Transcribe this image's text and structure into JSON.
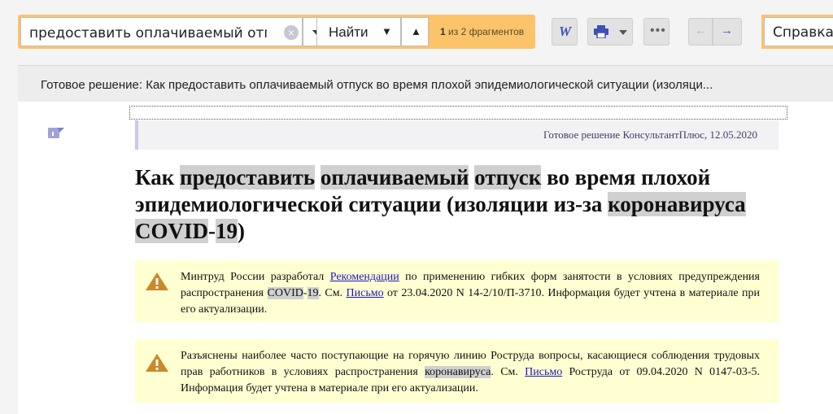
{
  "search": {
    "query": "предоставить оплачиваемый отп",
    "find_label": "Найти",
    "find_next_icon": "arrow-down",
    "find_prev_icon": "arrow-up",
    "count_current": "1",
    "count_suffix": "из 2 фрагментов"
  },
  "toolbar": {
    "word_label": "W",
    "more_label": "•••",
    "back_glyph": "←",
    "forward_glyph": "→",
    "help_label": "Справка"
  },
  "doc": {
    "header_title": "Готовое решение: Как предоставить оплачиваемый отпуск во время плохой эпидемиологической ситуации (изоляци...",
    "source": "Готовое решение КонсультантПлюс, 12.05.2020",
    "title_parts": {
      "p1": "Как ",
      "h1": "предоставить",
      "p2": " ",
      "h2": "оплачиваемый",
      "p3": " ",
      "h3": "отпуск",
      "p4": " во время плохой эпидемиологической ситуации (изоляции из-за ",
      "h4": "коронавируса",
      "p5": " ",
      "h5": "COVID",
      "p6": "-",
      "h6": "19",
      "p7": ")"
    },
    "warning1": {
      "t1": "Минтруд России разработал ",
      "link1": "Рекомендации",
      "t2": " по применению гибких форм занятости в условиях предупреждения распространения ",
      "hl1": "COVID",
      "t3": "-",
      "hl2": "19",
      "t4": ". См. ",
      "link2": "Письмо",
      "t5": " от 23.04.2020 N 14-2/10/П-3710. Информация будет учтена в материале при его актуализации."
    },
    "warning2": {
      "t1": "Разъяснены наиболее часто поступающие на горячую линию Роструда вопросы, касающиеся соблюдения трудовых прав работников в условиях распространения ",
      "hl1": "коронавируса",
      "t2": ". См. ",
      "link1": "Письмо",
      "t3": " Роструда от 09.04.2020 N 0147-03-5. Информация будет учтена в материале при его актуализации."
    }
  },
  "colors": {
    "search_accent": "#fbc46b",
    "link": "#1a1ab8",
    "highlight": "#d0d0d0",
    "warning_bg": "#ffffd2",
    "warning_icon": "#c98a2a"
  }
}
